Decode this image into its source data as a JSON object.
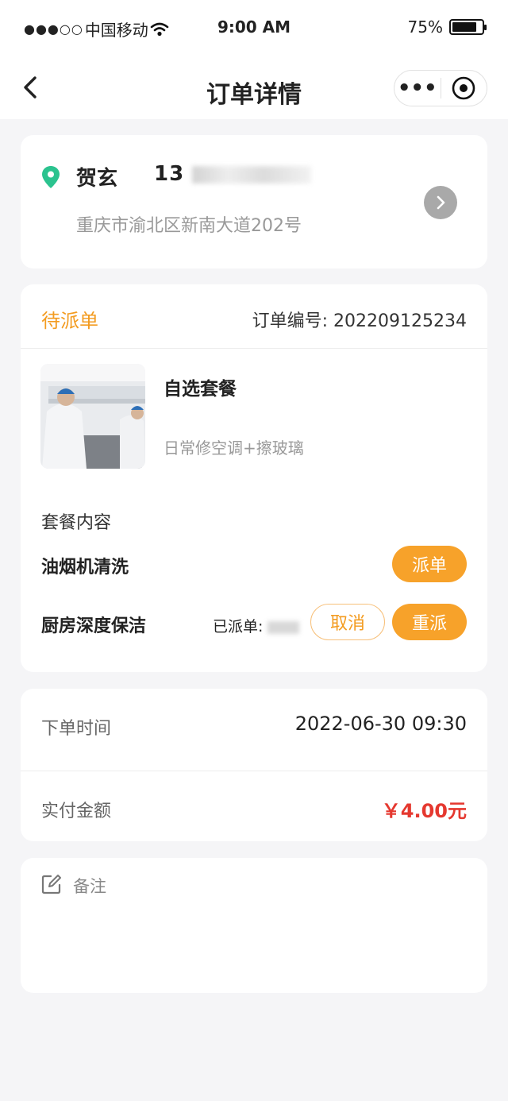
{
  "status_bar": {
    "carrier": "中国移动",
    "signal_dots": "●●●○○",
    "time": "9:00 AM",
    "battery": "75%"
  },
  "nav": {
    "title": "订单详情",
    "more_label": "•••"
  },
  "address": {
    "name": "贺玄",
    "phone": "13",
    "address": "重庆市渝北区新南大道202号"
  },
  "order": {
    "status": "待派单",
    "order_no_label": "订单编号:",
    "order_no": "202209125234",
    "package_title": "自选套餐",
    "package_sub": "日常修空调+擦玻璃",
    "content_label": "套餐内容",
    "items": [
      {
        "name": "油烟机清洗",
        "action": "派单"
      },
      {
        "name": "厨房深度保洁",
        "assigned": "已派单:",
        "cancel": "取消",
        "reassign": "重派"
      }
    ]
  },
  "info": {
    "time_label": "下单时间",
    "time_value": "2022-06-30 09:30",
    "paid_label": "实付金额",
    "paid_value": "￥4.00元"
  },
  "note": {
    "label": "备注"
  },
  "colors": {
    "accent": "#f7a22a",
    "status": "#f39b1f",
    "price": "#e5382f",
    "pin": "#2bc38f"
  }
}
